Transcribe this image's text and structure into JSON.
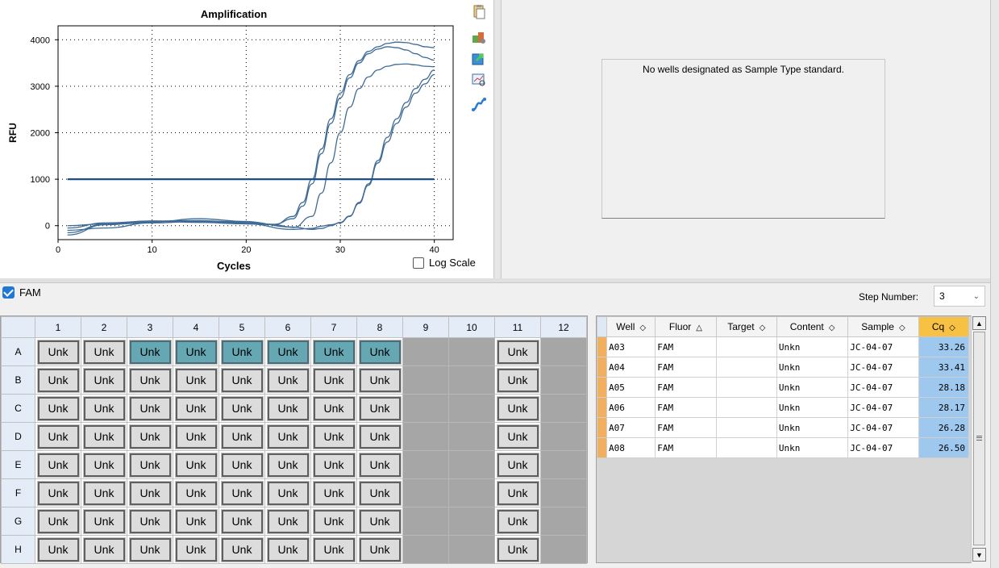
{
  "chart_data": {
    "type": "line",
    "title": "Amplification",
    "xlabel": "Cycles",
    "ylabel": "RFU",
    "xlim": [
      0,
      42
    ],
    "ylim": [
      -300,
      4300
    ],
    "xticks": [
      0,
      10,
      20,
      30,
      40
    ],
    "yticks": [
      0,
      1000,
      2000,
      3000,
      4000
    ],
    "grid": true,
    "threshold": 1000,
    "series": [
      {
        "x": [
          1,
          5,
          10,
          15,
          20,
          23,
          25,
          26,
          27,
          28,
          29,
          30,
          31,
          32,
          33,
          34,
          35,
          36,
          37,
          38,
          39,
          40
        ],
        "y": [
          -100,
          -50,
          60,
          90,
          40,
          20,
          200,
          500,
          1000,
          1650,
          2300,
          2850,
          3250,
          3550,
          3750,
          3850,
          3920,
          3950,
          3940,
          3900,
          3850,
          3830
        ]
      },
      {
        "x": [
          1,
          5,
          10,
          15,
          20,
          23,
          25,
          26,
          27,
          28,
          29,
          30,
          31,
          32,
          33,
          34,
          35,
          36,
          37,
          38,
          39,
          40
        ],
        "y": [
          0,
          40,
          100,
          110,
          60,
          30,
          150,
          420,
          900,
          1550,
          2200,
          2750,
          3180,
          3500,
          3700,
          3800,
          3850,
          3830,
          3780,
          3700,
          3620,
          3560
        ]
      },
      {
        "x": [
          1,
          5,
          10,
          15,
          20,
          23,
          25,
          27,
          28,
          29,
          30,
          31,
          32,
          33,
          34,
          35,
          36,
          37,
          38,
          39,
          40
        ],
        "y": [
          -200,
          20,
          80,
          150,
          90,
          20,
          -40,
          200,
          700,
          1350,
          2000,
          2550,
          2950,
          3200,
          3350,
          3430,
          3470,
          3480,
          3460,
          3430,
          3420
        ]
      },
      {
        "x": [
          1,
          5,
          10,
          15,
          20,
          25,
          27,
          28,
          29,
          30,
          31,
          32,
          33,
          34,
          35,
          36,
          37,
          38,
          39,
          40
        ],
        "y": [
          -50,
          60,
          100,
          70,
          40,
          -80,
          -60,
          -10,
          20,
          60,
          200,
          500,
          900,
          1400,
          1900,
          2300,
          2650,
          2950,
          3150,
          3350
        ]
      },
      {
        "x": [
          1,
          5,
          10,
          15,
          20,
          25,
          27,
          28,
          29,
          30,
          31,
          32,
          33,
          34,
          35,
          36,
          37,
          38,
          39,
          40
        ],
        "y": [
          -150,
          30,
          60,
          100,
          80,
          -30,
          -80,
          -60,
          0,
          70,
          210,
          480,
          870,
          1350,
          1800,
          2200,
          2550,
          2850,
          3050,
          3250
        ]
      }
    ]
  },
  "toolbar": {
    "icons": [
      "copy-icon",
      "properties-icon",
      "export-icon",
      "zoom-icon",
      "curve-icon"
    ]
  },
  "log_scale_label": "Log Scale",
  "standard_message": "No wells designated as Sample Type standard.",
  "fluor": {
    "label": "FAM",
    "checked": true
  },
  "step": {
    "label": "Step Number:",
    "value": "3"
  },
  "plate": {
    "columns": [
      "1",
      "2",
      "3",
      "4",
      "5",
      "6",
      "7",
      "8",
      "9",
      "10",
      "11",
      "12"
    ],
    "rows": [
      "A",
      "B",
      "C",
      "D",
      "E",
      "F",
      "G",
      "H"
    ],
    "well_label": "Unk",
    "filled_columns": [
      1,
      2,
      3,
      4,
      5,
      6,
      7,
      8,
      11
    ],
    "selected_wells": [
      "A3",
      "A4",
      "A5",
      "A6",
      "A7",
      "A8"
    ]
  },
  "results": {
    "headers": [
      "Well",
      "Fluor",
      "Target",
      "Content",
      "Sample",
      "Cq"
    ],
    "rows": [
      {
        "well": "A03",
        "fluor": "FAM",
        "target": "",
        "content": "Unkn",
        "sample": "JC-04-07",
        "cq": "33.26"
      },
      {
        "well": "A04",
        "fluor": "FAM",
        "target": "",
        "content": "Unkn",
        "sample": "JC-04-07",
        "cq": "33.41"
      },
      {
        "well": "A05",
        "fluor": "FAM",
        "target": "",
        "content": "Unkn",
        "sample": "JC-04-07",
        "cq": "28.18"
      },
      {
        "well": "A06",
        "fluor": "FAM",
        "target": "",
        "content": "Unkn",
        "sample": "JC-04-07",
        "cq": "28.17"
      },
      {
        "well": "A07",
        "fluor": "FAM",
        "target": "",
        "content": "Unkn",
        "sample": "JC-04-07",
        "cq": "26.28"
      },
      {
        "well": "A08",
        "fluor": "FAM",
        "target": "",
        "content": "Unkn",
        "sample": "JC-04-07",
        "cq": "26.50"
      }
    ]
  },
  "colors": {
    "curve": "#3e6a96",
    "threshold": "#1a4f8c",
    "selected_well": "#66a7b4",
    "cq_cell": "#9fc8ee"
  }
}
